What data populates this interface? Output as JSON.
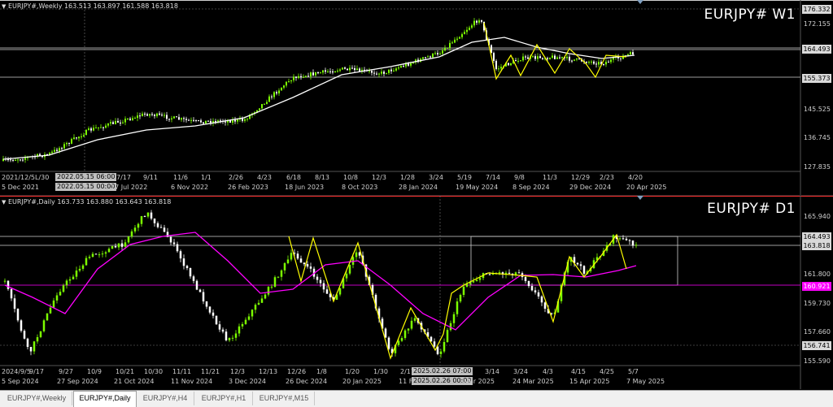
{
  "weekly": {
    "ohlc_label": "EURJPY#,Weekly  163.513 163.897 161.588 163.818",
    "title": "EURJPY# W1",
    "price_ticks": [
      "172.155",
      "164.493",
      "155.373",
      "145.525",
      "136.745",
      "127.835"
    ],
    "badges": {
      "top": "176.332",
      "level_a": "164.493",
      "level_b": "155.373"
    },
    "time_ticks": [
      "2021/12/5L/30",
      "5 Dec 2021",
      "7/17",
      "17 Jul 2022",
      "9/11",
      "11/6",
      "6 Nov 2022",
      "1/1",
      "2/26",
      "26 Feb 2023",
      "4/23",
      "6/18",
      "18 Jun 2023",
      "8/13",
      "10/8",
      "8 Oct 2023",
      "12/3",
      "1/28",
      "28 Jan 2024",
      "3/24",
      "5/19",
      "19 May 2024",
      "7/14",
      "9/8",
      "8 Sep 2024",
      "11/3",
      "12/29",
      "29 Dec 2024",
      "2/23",
      "4/20",
      "20 Apr 2025"
    ],
    "cross_top": "2022.05.15 06:00",
    "cross_bottom": "2022.05.15 00:00"
  },
  "daily": {
    "ohlc_label": "EURJPY#,Daily  163.733 163.880 163.643 163.818",
    "title": "EURJPY# D1",
    "price_ticks": [
      "165.940",
      "161.800",
      "159.730",
      "157.660",
      "155.590"
    ],
    "badges": {
      "level_a": "164.493",
      "current": "163.818",
      "ma": "160.921",
      "bottom": "156.741"
    },
    "time_ticks": [
      "2024/9/5",
      "9/17",
      "5 Sep 2024",
      "9/27",
      "27 Sep 2024",
      "10/9",
      "10/21",
      "21 Oct 2024",
      "10/30",
      "11/11",
      "11 Nov 2024",
      "11/21",
      "12/3",
      "3 Dec 2024",
      "12/13",
      "12/26",
      "26 Dec 2024",
      "1/8",
      "1/20",
      "20 Jan 2025",
      "1/30",
      "2/11",
      "11 F",
      "3/14",
      "3/24",
      "24 Mar 2025",
      "4/3",
      "4/15",
      "15 Apr 2025",
      "4/25",
      "5/7",
      "7 May 2025",
      "Mar 2025"
    ],
    "cross_top": "2025.02.26 07:00",
    "cross_bottom": "2025.02.26 00:00"
  },
  "tabs": [
    {
      "label": "EURJPY#,Weekly",
      "active": false
    },
    {
      "label": "EURJPY#,Daily",
      "active": true
    },
    {
      "label": "EURJPY#,H4",
      "active": false
    },
    {
      "label": "EURJPY#,H1",
      "active": false
    },
    {
      "label": "EURJPY#,M15",
      "active": false
    }
  ],
  "colors": {
    "bull": "#7CFC00",
    "bear": "#ffffff",
    "ma_weekly": "#ffffff",
    "ma_daily": "#ff00ff",
    "zigzag": "#ffff00",
    "grid": "#2f2f2f"
  }
}
